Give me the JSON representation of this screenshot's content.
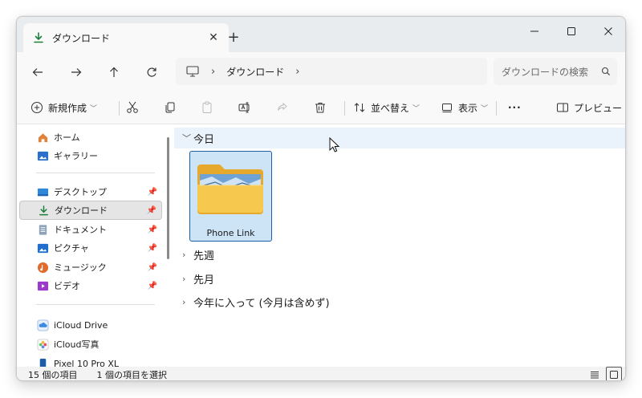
{
  "tab": {
    "title": "ダウンロード",
    "close_glyph": "✕",
    "new_tab_glyph": "+"
  },
  "window_controls": {
    "minimize": "—",
    "maximize": "☐",
    "close": "✕"
  },
  "nav": {
    "back": "←",
    "forward": "→",
    "up": "↑",
    "refresh": "C"
  },
  "address": {
    "separator1": "›",
    "crumb": "ダウンロード",
    "separator2": "›"
  },
  "search": {
    "placeholder": "ダウンロードの検索"
  },
  "toolbar": {
    "new_label": "新規作成",
    "sort_label": "並べ替え",
    "view_label": "表示",
    "more_label": "···",
    "preview_label": "プレビュー"
  },
  "sidebar": {
    "items": [
      {
        "label": "ホーム",
        "icon": "home-icon"
      },
      {
        "label": "ギャラリー",
        "icon": "gallery-icon"
      },
      {
        "label": "デスクトップ",
        "icon": "desktop-icon",
        "pinned": true
      },
      {
        "label": "ダウンロード",
        "icon": "download-icon",
        "pinned": true,
        "selected": true
      },
      {
        "label": "ドキュメント",
        "icon": "documents-icon",
        "pinned": true
      },
      {
        "label": "ピクチャ",
        "icon": "pictures-icon",
        "pinned": true
      },
      {
        "label": "ミュージック",
        "icon": "music-icon",
        "pinned": true
      },
      {
        "label": "ビデオ",
        "icon": "videos-icon",
        "pinned": true
      },
      {
        "label": "iCloud Drive",
        "icon": "icloud-drive-icon"
      },
      {
        "label": "iCloud写真",
        "icon": "icloud-photos-icon"
      },
      {
        "label": "Pixel 10 Pro XL",
        "icon": "phone-icon"
      }
    ]
  },
  "groups": {
    "today": "今日",
    "last_week": "先週",
    "last_month": "先月",
    "this_year": "今年に入って (今月は含めず)"
  },
  "files": [
    {
      "name": "Phone Link",
      "type": "folder"
    }
  ],
  "status": {
    "count": "15 個の項目",
    "selected": "1 個の項目を選択"
  },
  "colors": {
    "accent": "#1d5ea8",
    "selection_bg": "#cde4f7",
    "group_hover": "#eaf2fb",
    "folder": "#f6c84e"
  }
}
